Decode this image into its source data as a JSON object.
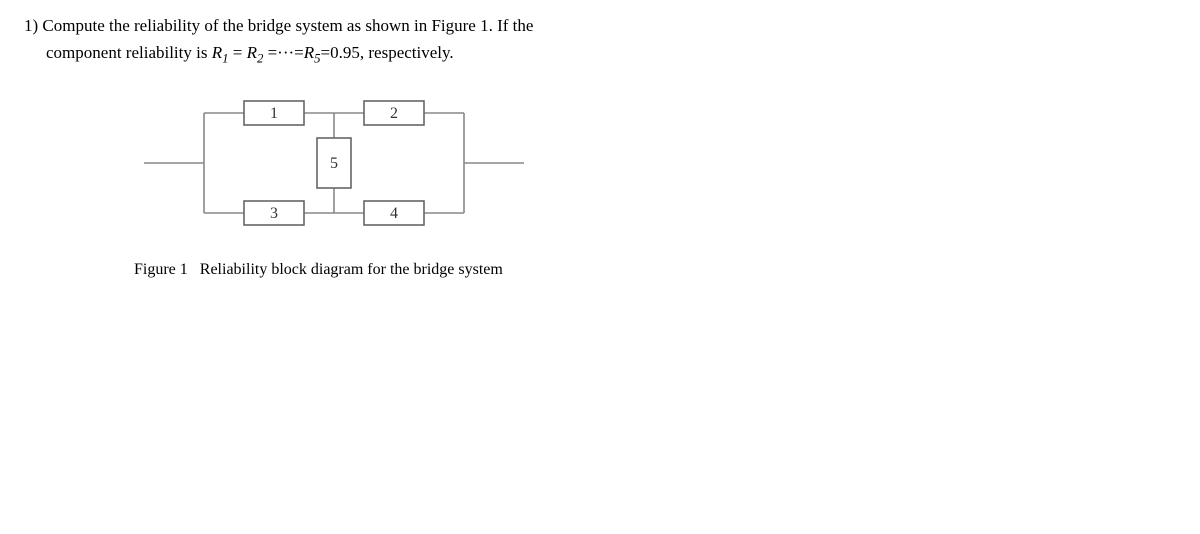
{
  "question": {
    "line1_prefix": "1) Compute the reliability of the bridge system as shown in Figure 1. If the",
    "line2_prefix": "component reliability is ",
    "line2_eq_part1_var": "R",
    "line2_eq_part1_sub": "1",
    "line2_eq_eq1": " = ",
    "line2_eq_part2_var": "R",
    "line2_eq_part2_sub": "2",
    "line2_eq_eq2": " =···=",
    "line2_eq_part3_var": "R",
    "line2_eq_part3_sub": "5",
    "line2_eq_value": "=0.95, respectively."
  },
  "diagram": {
    "block_labels": {
      "b1": "1",
      "b2": "2",
      "b3": "3",
      "b4": "4",
      "b5": "5"
    }
  },
  "caption": {
    "label": "Figure 1",
    "text": "Reliability block diagram for the bridge system"
  }
}
